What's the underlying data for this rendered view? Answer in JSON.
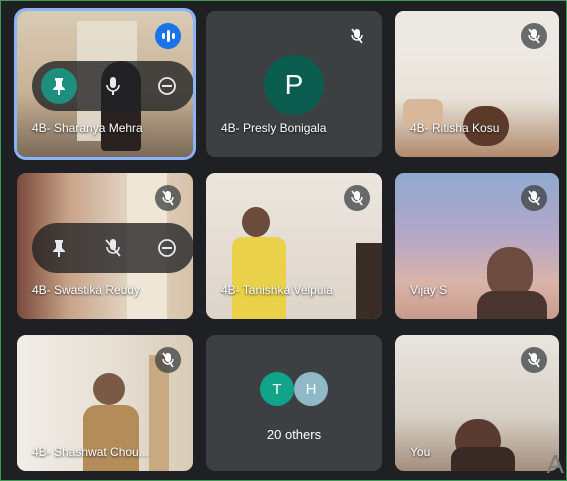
{
  "tiles": [
    {
      "name": "4B- Sharanya Mehra",
      "status": "speaking"
    },
    {
      "name": "4B- Presly Bonigala",
      "status": "muted",
      "avatar_letter": "P",
      "avatar_color": "#0b5d4f"
    },
    {
      "name": "4B- Ritisha Kosu",
      "status": "muted"
    },
    {
      "name": "4B- Swastika Reddy",
      "status": "muted"
    },
    {
      "name": "4B- Tanishka Velpula",
      "status": "muted"
    },
    {
      "name": "Vijay S",
      "status": "muted"
    },
    {
      "name": "4B- Shashwat Chou...",
      "status": "muted"
    },
    {
      "others_label": "20 others",
      "avatars": [
        {
          "letter": "T",
          "color": "#12a48a"
        },
        {
          "letter": "H",
          "color": "#8fb9c7"
        }
      ]
    },
    {
      "name": "You",
      "status": "muted"
    }
  ],
  "hover_controls": {
    "icons": [
      "pin-icon",
      "mic-icon",
      "remove-icon"
    ]
  },
  "watermark": "A",
  "colors": {
    "accent": "#8ab4f8",
    "speaking": "#1a73e8",
    "pin": "#1e8e7e",
    "background": "#202124"
  }
}
